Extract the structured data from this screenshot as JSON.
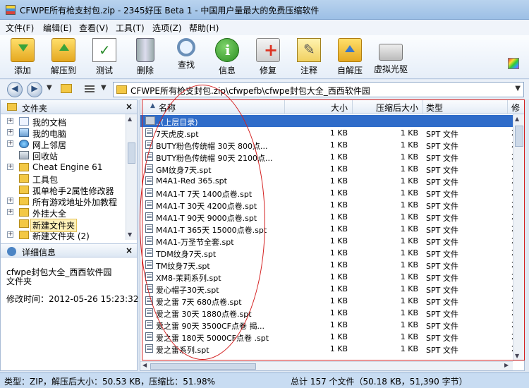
{
  "window": {
    "title": "CFWPE所有枪支封包.zip - 2345好压 Beta 1 - 中国用户量最大的免费压缩软件"
  },
  "menu": [
    "文件(F)",
    "编辑(E)",
    "查看(V)",
    "工具(T)",
    "选项(Z)",
    "帮助(H)"
  ],
  "toolbar": [
    {
      "label": "添加",
      "icon": "add-archive-icon"
    },
    {
      "label": "解压到",
      "icon": "extract-icon"
    },
    {
      "label": "测试",
      "icon": "test-checklist-icon"
    },
    {
      "label": "删除",
      "icon": "trash-icon"
    },
    {
      "label": "查找",
      "icon": "magnifier-icon"
    },
    {
      "label": "信息",
      "icon": "info-icon"
    },
    {
      "label": "修复",
      "icon": "repair-kit-icon"
    },
    {
      "label": "注释",
      "icon": "comment-pencil-icon"
    },
    {
      "label": "自解压",
      "icon": "sfx-icon"
    },
    {
      "label": "虚拟光驱",
      "icon": "virtual-drive-icon"
    }
  ],
  "address": {
    "path": "CFWPE所有枪支封包.zip\\cfwpefb\\cfwpe封包大全_西西软件园"
  },
  "folders_panel": {
    "title": "文件夹",
    "items": [
      {
        "label": "我的文档",
        "icon": "documents-icon"
      },
      {
        "label": "我的电脑",
        "icon": "computer-icon"
      },
      {
        "label": "网上邻居",
        "icon": "network-icon"
      },
      {
        "label": "回收站",
        "icon": "recycle-bin-icon"
      },
      {
        "label": "Cheat Engine 61",
        "icon": "folder-icon"
      },
      {
        "label": "工具包",
        "icon": "folder-icon"
      },
      {
        "label": "孤单枪手2属性修改器",
        "icon": "folder-icon"
      },
      {
        "label": "所有游戏地址外加教程",
        "icon": "folder-icon"
      },
      {
        "label": "外挂大全",
        "icon": "folder-icon"
      },
      {
        "label": "新建文件夹",
        "icon": "folder-icon"
      },
      {
        "label": "新建文件夹 (2)",
        "icon": "folder-icon"
      }
    ]
  },
  "details_panel": {
    "title": "详细信息",
    "name": "cfwpe封包大全_西西软件园",
    "type": "文件夹",
    "modified": "修改时间：2012-05-26 15:23:32"
  },
  "columns": [
    "名称",
    "大小",
    "压缩后大小",
    "类型",
    "修"
  ],
  "up_row": {
    "name": "..(上层目录)"
  },
  "files": [
    {
      "name": "7天虎皮.spt",
      "size": "1 KB",
      "packed": "1 KB",
      "type": "SPT 文件",
      "extra": "2"
    },
    {
      "name": "BUTY粉色传统帽 30天 800点...",
      "size": "1 KB",
      "packed": "1 KB",
      "type": "SPT 文件",
      "extra": "2"
    },
    {
      "name": "BUTY粉色传统帽 90天 2100点...",
      "size": "1 KB",
      "packed": "1 KB",
      "type": "SPT 文件",
      "extra": "2"
    },
    {
      "name": "GM纹身7天.spt",
      "size": "1 KB",
      "packed": "1 KB",
      "type": "SPT 文件",
      "extra": "2"
    },
    {
      "name": "M4A1-Red 365.spt",
      "size": "1 KB",
      "packed": "1 KB",
      "type": "SPT 文件",
      "extra": "2"
    },
    {
      "name": "M4A1-T 7天 1400点卷.spt",
      "size": "1 KB",
      "packed": "1 KB",
      "type": "SPT 文件",
      "extra": "2"
    },
    {
      "name": "M4A1-T 30天 4200点卷.spt",
      "size": "1 KB",
      "packed": "1 KB",
      "type": "SPT 文件",
      "extra": "2"
    },
    {
      "name": "M4A1-T 90天 9000点卷.spt",
      "size": "1 KB",
      "packed": "1 KB",
      "type": "SPT 文件",
      "extra": "2"
    },
    {
      "name": "M4A1-T 365天 15000点卷.spt",
      "size": "1 KB",
      "packed": "1 KB",
      "type": "SPT 文件",
      "extra": "2"
    },
    {
      "name": "M4A1-万圣节全套.spt",
      "size": "1 KB",
      "packed": "1 KB",
      "type": "SPT 文件",
      "extra": "2"
    },
    {
      "name": "TDM纹身7天.spt",
      "size": "1 KB",
      "packed": "1 KB",
      "type": "SPT 文件",
      "extra": "2"
    },
    {
      "name": "TM纹身7天.spt",
      "size": "1 KB",
      "packed": "1 KB",
      "type": "SPT 文件",
      "extra": "2"
    },
    {
      "name": "XM8-茉莉系列.spt",
      "size": "1 KB",
      "packed": "1 KB",
      "type": "SPT 文件",
      "extra": "2"
    },
    {
      "name": "爱心帽子30天.spt",
      "size": "1 KB",
      "packed": "1 KB",
      "type": "SPT 文件",
      "extra": "2"
    },
    {
      "name": "爱之雷 7天 680点卷.spt",
      "size": "1 KB",
      "packed": "1 KB",
      "type": "SPT 文件",
      "extra": "2"
    },
    {
      "name": "爱之雷 30天 1880点卷.spt",
      "size": "1 KB",
      "packed": "1 KB",
      "type": "SPT 文件",
      "extra": "2"
    },
    {
      "name": "爱之雷 90天 3500CF点卷 揭...",
      "size": "1 KB",
      "packed": "1 KB",
      "type": "SPT 文件",
      "extra": "2"
    },
    {
      "name": "爱之雷 180天 5000CF点卷 .spt",
      "size": "1 KB",
      "packed": "1 KB",
      "type": "SPT 文件",
      "extra": "2"
    },
    {
      "name": "爱之雷系列.spt",
      "size": "1 KB",
      "packed": "1 KB",
      "type": "SPT 文件",
      "extra": "2"
    }
  ],
  "status": {
    "left": "类型：ZIP，解压后大小：50.53 KB，压缩比：51.98%",
    "right": "总计 157 个文件（50.18 KB，51,390 字节）"
  },
  "colors": {
    "selection": "#2f6cc9",
    "annotation": "#d42020"
  }
}
